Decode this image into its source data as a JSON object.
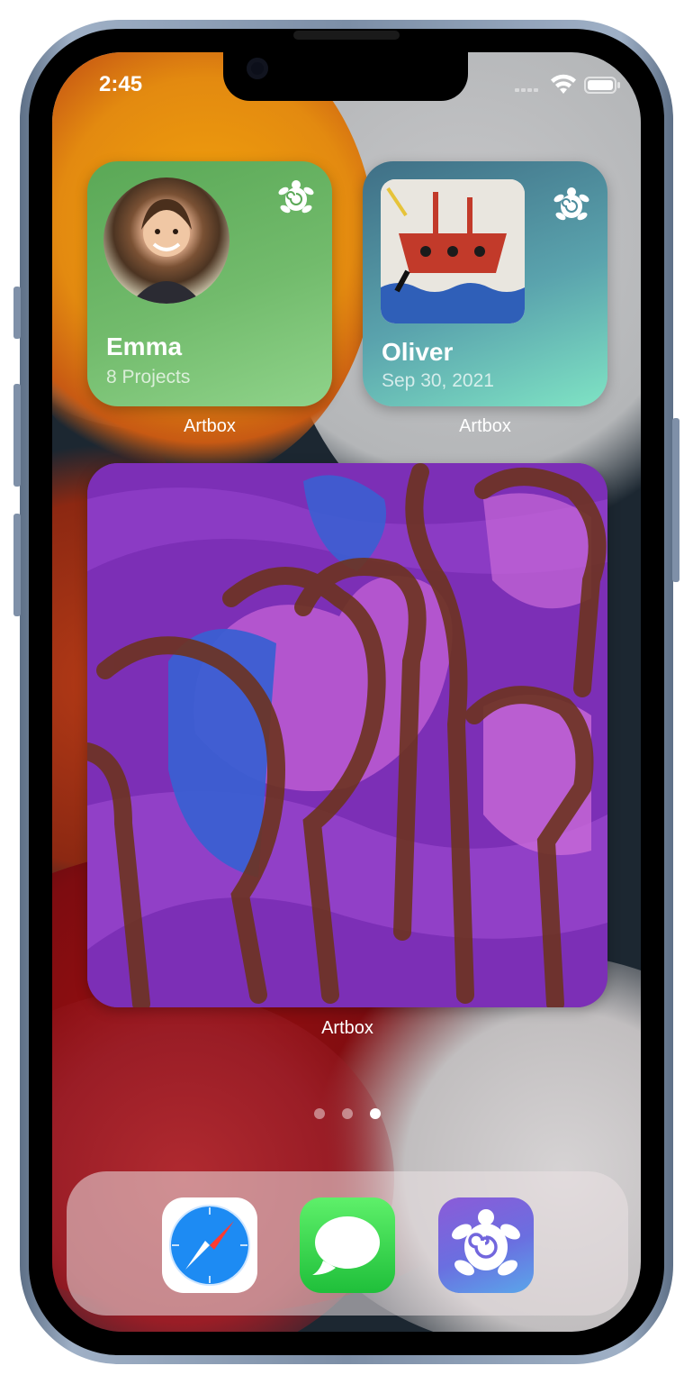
{
  "status_bar": {
    "time": "2:45"
  },
  "widgets": [
    {
      "id": "emma",
      "name": "Emma",
      "subtitle": "8 Projects",
      "app_label": "Artbox",
      "background": "#6fb468",
      "icon": "turtle-icon"
    },
    {
      "id": "oliver",
      "name": "Oliver",
      "subtitle": "Sep 30, 2021",
      "app_label": "Artbox",
      "background": "#5fa8b0",
      "icon": "turtle-icon"
    },
    {
      "id": "large",
      "app_label": "Artbox"
    }
  ],
  "page_indicator": {
    "pages": 3,
    "current": 3
  },
  "dock": [
    {
      "name": "safari-icon",
      "color": "#1e88f0"
    },
    {
      "name": "messages-icon",
      "color": "#34c759"
    },
    {
      "name": "artbox-icon",
      "color": "#7c63d8"
    }
  ]
}
